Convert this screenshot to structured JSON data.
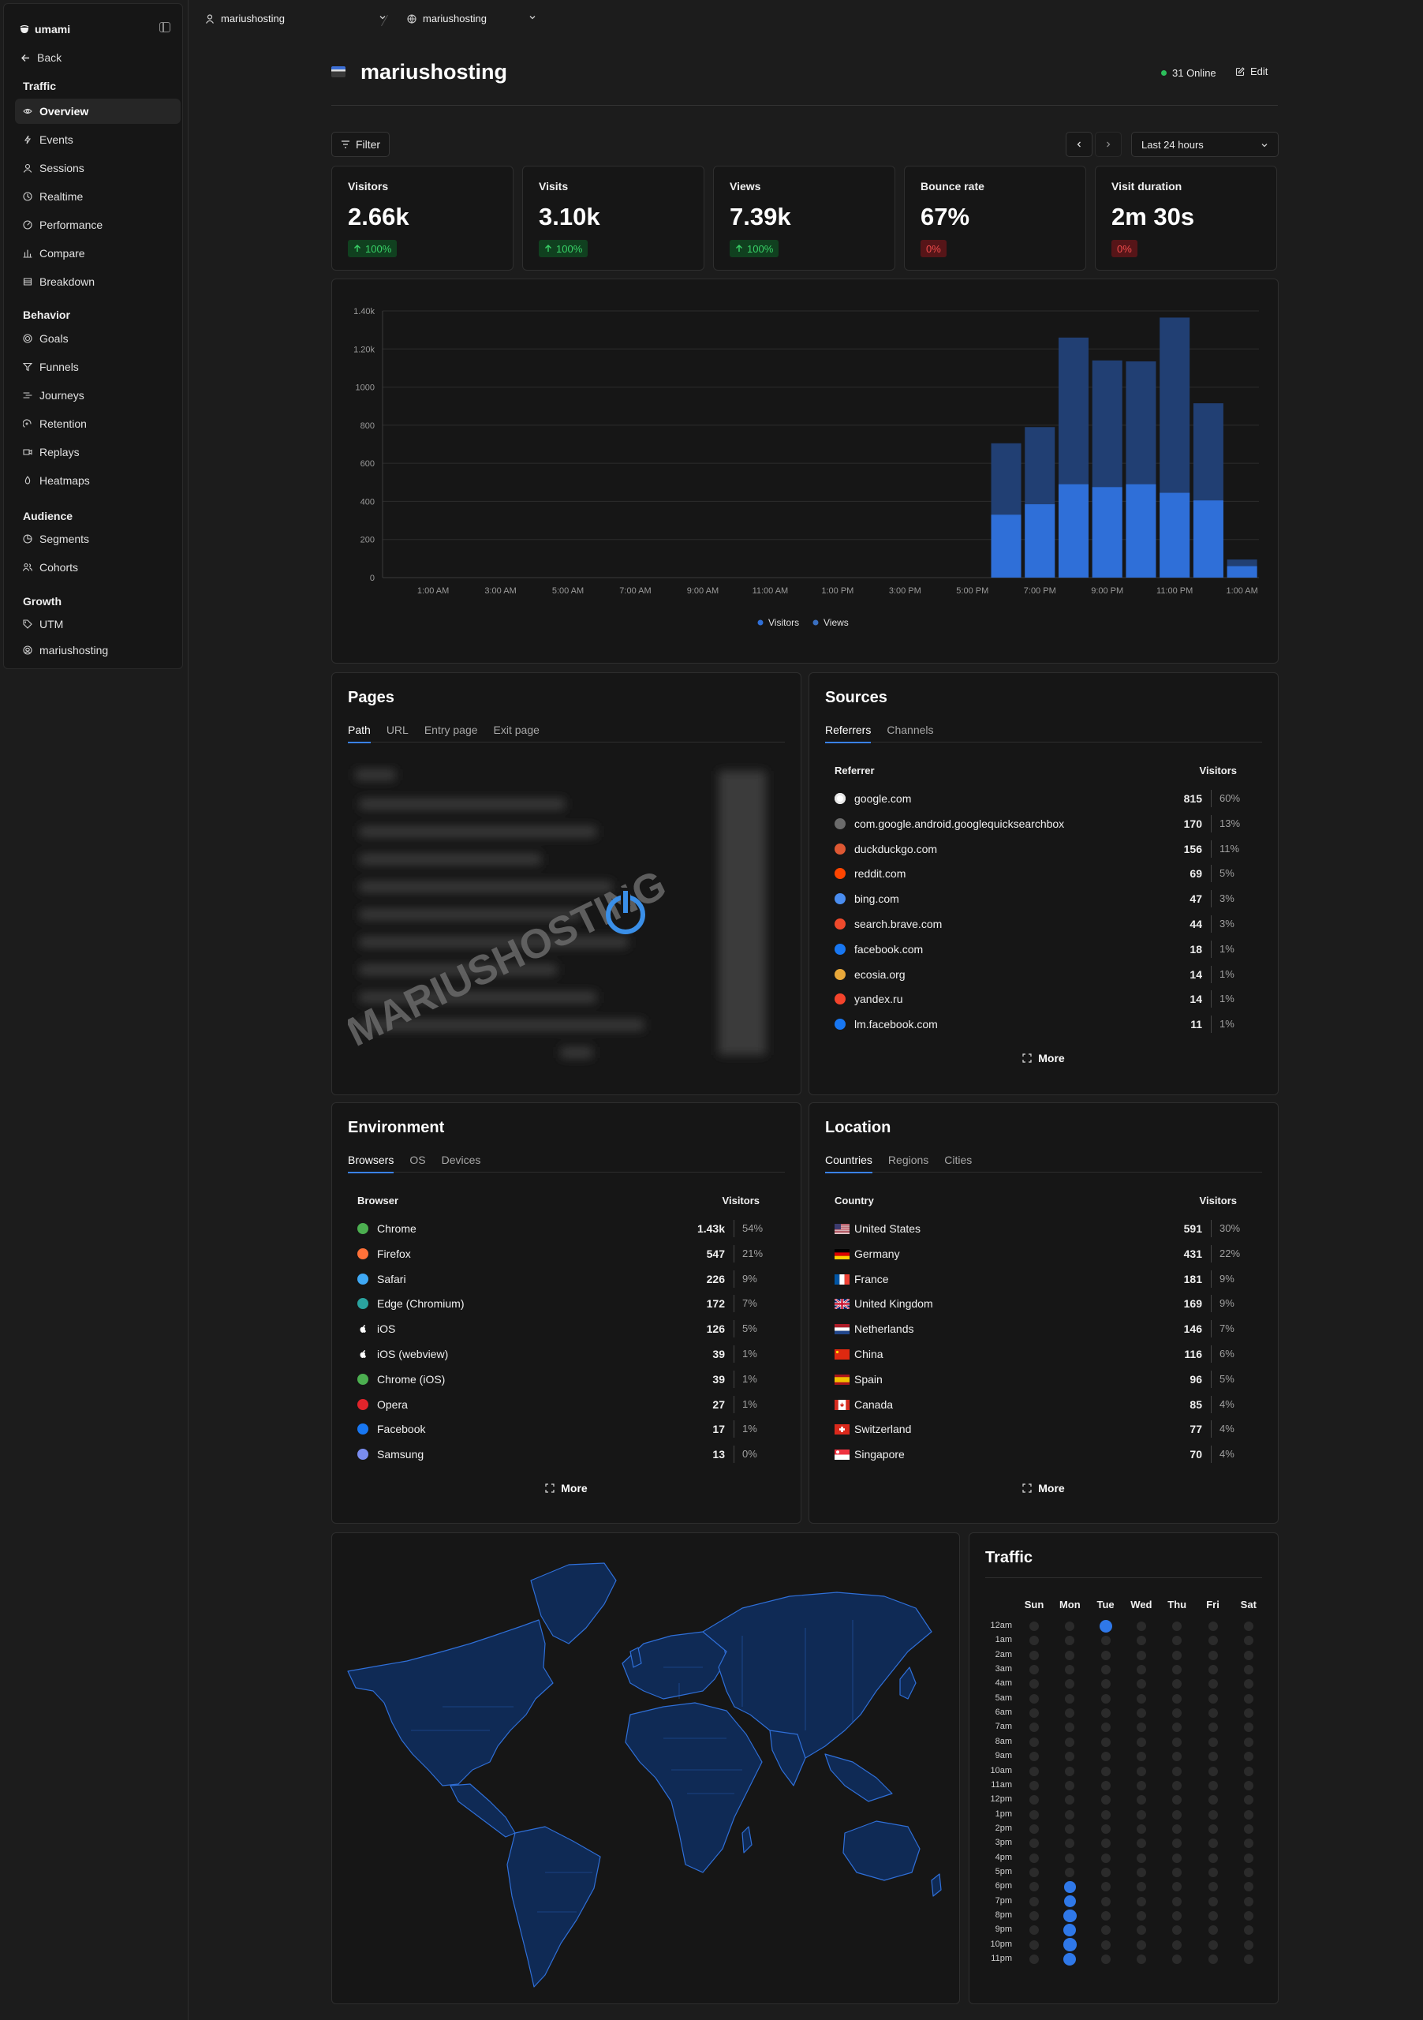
{
  "sidebar": {
    "brand": "umami",
    "back": "Back",
    "sections": [
      {
        "title": "Traffic",
        "items": [
          "Overview",
          "Events",
          "Sessions",
          "Realtime",
          "Performance",
          "Compare",
          "Breakdown"
        ]
      },
      {
        "title": "Behavior",
        "items": [
          "Goals",
          "Funnels",
          "Journeys",
          "Retention",
          "Replays",
          "Heatmaps"
        ]
      },
      {
        "title": "Audience",
        "items": [
          "Segments",
          "Cohorts"
        ]
      },
      {
        "title": "Growth",
        "items": [
          "UTM",
          "mariushosting"
        ]
      }
    ],
    "active_item": "Overview"
  },
  "topbar": {
    "team": "mariushosting",
    "website": "mariushosting"
  },
  "header": {
    "title": "mariushosting",
    "online": "31 Online",
    "edit_label": "Edit"
  },
  "filter": {
    "label": "Filter",
    "date_range": "Last 24 hours"
  },
  "metrics": [
    {
      "label": "Visitors",
      "value": "2.66k",
      "change": "100%",
      "trend": "up"
    },
    {
      "label": "Visits",
      "value": "3.10k",
      "change": "100%",
      "trend": "up"
    },
    {
      "label": "Views",
      "value": "7.39k",
      "change": "100%",
      "trend": "up"
    },
    {
      "label": "Bounce rate",
      "value": "67%",
      "change": "0%",
      "trend": "down"
    },
    {
      "label": "Visit duration",
      "value": "2m 30s",
      "change": "0%",
      "trend": "down"
    }
  ],
  "chart_data": {
    "type": "bar",
    "stacked": "overlay",
    "categories": [
      "12 AM",
      "1 AM",
      "2 AM",
      "3 AM",
      "4 AM",
      "5 AM",
      "6 AM",
      "7 AM",
      "8 AM",
      "9 AM",
      "10 AM",
      "11 AM",
      "12 PM",
      "1 PM",
      "2 PM",
      "3 PM",
      "4 PM",
      "5 PM",
      "6 PM",
      "7 PM",
      "8 PM",
      "9 PM",
      "10 PM",
      "11 PM",
      "12 AM",
      "1 AM"
    ],
    "tick_labels": [
      "1:00 AM",
      "3:00 AM",
      "5:00 AM",
      "7:00 AM",
      "9:00 AM",
      "11:00 AM",
      "1:00 PM",
      "3:00 PM",
      "5:00 PM",
      "7:00 PM",
      "9:00 PM",
      "11:00 PM",
      "1:00 AM"
    ],
    "series": [
      {
        "name": "Visitors",
        "color": "#2f6fd8",
        "values": [
          0,
          0,
          0,
          0,
          0,
          0,
          0,
          0,
          0,
          0,
          0,
          0,
          0,
          0,
          0,
          0,
          0,
          0,
          330,
          385,
          490,
          475,
          490,
          445,
          405,
          60
        ]
      },
      {
        "name": "Views",
        "color": "#213f73",
        "values": [
          0,
          0,
          0,
          0,
          0,
          0,
          0,
          0,
          0,
          0,
          0,
          0,
          0,
          0,
          0,
          0,
          0,
          0,
          705,
          790,
          1260,
          1140,
          1135,
          1365,
          915,
          95
        ]
      }
    ],
    "y_ticks": [
      "0",
      "200",
      "400",
      "600",
      "800",
      "1000",
      "1.20k",
      "1.40k"
    ],
    "ylim": [
      0,
      1400
    ],
    "legend": [
      "Visitors",
      "Views"
    ],
    "legend_position": "bottom"
  },
  "pages": {
    "title": "Pages",
    "tabs": [
      "Path",
      "URL",
      "Entry page",
      "Exit page"
    ],
    "watermark": "MARIUSHOSTING"
  },
  "sources": {
    "title": "Sources",
    "tabs": [
      "Referrers",
      "Channels"
    ],
    "col_label": "Referrer",
    "col_value": "Visitors",
    "rows": [
      {
        "label": "google.com",
        "value": "815",
        "pct": "60%",
        "icon": "google-icon",
        "color": "#e8e8e8"
      },
      {
        "label": "com.google.android.googlequicksearchbox",
        "value": "170",
        "pct": "13%",
        "icon": "app-icon",
        "color": "#6b6b6b"
      },
      {
        "label": "duckduckgo.com",
        "value": "156",
        "pct": "11%",
        "icon": "duckduckgo-icon",
        "color": "#de5833"
      },
      {
        "label": "reddit.com",
        "value": "69",
        "pct": "5%",
        "icon": "reddit-icon",
        "color": "#ff4500"
      },
      {
        "label": "bing.com",
        "value": "47",
        "pct": "3%",
        "icon": "search-icon",
        "color": "#4a8df0"
      },
      {
        "label": "search.brave.com",
        "value": "44",
        "pct": "3%",
        "icon": "brave-icon",
        "color": "#f04a2c"
      },
      {
        "label": "facebook.com",
        "value": "18",
        "pct": "1%",
        "icon": "facebook-icon",
        "color": "#1877f2"
      },
      {
        "label": "ecosia.org",
        "value": "14",
        "pct": "1%",
        "icon": "ecosia-icon",
        "color": "#e8a83a"
      },
      {
        "label": "yandex.ru",
        "value": "14",
        "pct": "1%",
        "icon": "yandex-icon",
        "color": "#f4442c"
      },
      {
        "label": "lm.facebook.com",
        "value": "11",
        "pct": "1%",
        "icon": "facebook-icon",
        "color": "#1877f2"
      }
    ],
    "more": "More"
  },
  "environment": {
    "title": "Environment",
    "tabs": [
      "Browsers",
      "OS",
      "Devices"
    ],
    "col_label": "Browser",
    "col_value": "Visitors",
    "rows": [
      {
        "label": "Chrome",
        "value": "1.43k",
        "pct": "54%",
        "icon": "chrome-icon",
        "color": "#4caf50"
      },
      {
        "label": "Firefox",
        "value": "547",
        "pct": "21%",
        "icon": "firefox-icon",
        "color": "#ff7139"
      },
      {
        "label": "Safari",
        "value": "226",
        "pct": "9%",
        "icon": "safari-icon",
        "color": "#3fa9f5"
      },
      {
        "label": "Edge (Chromium)",
        "value": "172",
        "pct": "7%",
        "icon": "edge-icon",
        "color": "#2aa39f"
      },
      {
        "label": "iOS",
        "value": "126",
        "pct": "5%",
        "icon": "apple-icon",
        "color": "#ffffff"
      },
      {
        "label": "iOS (webview)",
        "value": "39",
        "pct": "1%",
        "icon": "apple-icon",
        "color": "#ffffff"
      },
      {
        "label": "Chrome (iOS)",
        "value": "39",
        "pct": "1%",
        "icon": "chrome-icon",
        "color": "#4caf50"
      },
      {
        "label": "Opera",
        "value": "27",
        "pct": "1%",
        "icon": "opera-icon",
        "color": "#e0242b"
      },
      {
        "label": "Facebook",
        "value": "17",
        "pct": "1%",
        "icon": "facebook-icon",
        "color": "#1877f2"
      },
      {
        "label": "Samsung",
        "value": "13",
        "pct": "0%",
        "icon": "samsung-icon",
        "color": "#7a8df0"
      }
    ],
    "more": "More"
  },
  "location": {
    "title": "Location",
    "tabs": [
      "Countries",
      "Regions",
      "Cities"
    ],
    "col_label": "Country",
    "col_value": "Visitors",
    "rows": [
      {
        "label": "United States",
        "value": "591",
        "pct": "30%",
        "icon": "flag-us"
      },
      {
        "label": "Germany",
        "value": "431",
        "pct": "22%",
        "icon": "flag-de"
      },
      {
        "label": "France",
        "value": "181",
        "pct": "9%",
        "icon": "flag-fr"
      },
      {
        "label": "United Kingdom",
        "value": "169",
        "pct": "9%",
        "icon": "flag-gb"
      },
      {
        "label": "Netherlands",
        "value": "146",
        "pct": "7%",
        "icon": "flag-nl"
      },
      {
        "label": "China",
        "value": "116",
        "pct": "6%",
        "icon": "flag-cn"
      },
      {
        "label": "Spain",
        "value": "96",
        "pct": "5%",
        "icon": "flag-es"
      },
      {
        "label": "Canada",
        "value": "85",
        "pct": "4%",
        "icon": "flag-ca"
      },
      {
        "label": "Switzerland",
        "value": "77",
        "pct": "4%",
        "icon": "flag-ch"
      },
      {
        "label": "Singapore",
        "value": "70",
        "pct": "4%",
        "icon": "flag-sg"
      }
    ],
    "more": "More"
  },
  "traffic": {
    "title": "Traffic",
    "days": [
      "Sun",
      "Mon",
      "Tue",
      "Wed",
      "Thu",
      "Fri",
      "Sat"
    ],
    "hours": [
      "12am",
      "1am",
      "2am",
      "3am",
      "4am",
      "5am",
      "6am",
      "7am",
      "8am",
      "9am",
      "10am",
      "11am",
      "12pm",
      "1pm",
      "2pm",
      "3pm",
      "4pm",
      "5pm",
      "6pm",
      "7pm",
      "8pm",
      "9pm",
      "10pm",
      "11pm"
    ],
    "active_cells": [
      {
        "day": "Tue",
        "hour": "12am",
        "level": 0.7
      },
      {
        "day": "Mon",
        "hour": "6pm",
        "level": 0.45
      },
      {
        "day": "Mon",
        "hour": "7pm",
        "level": 0.55
      },
      {
        "day": "Mon",
        "hour": "8pm",
        "level": 0.75
      },
      {
        "day": "Mon",
        "hour": "9pm",
        "level": 0.7
      },
      {
        "day": "Mon",
        "hour": "10pm",
        "level": 0.75
      },
      {
        "day": "Mon",
        "hour": "11pm",
        "level": 0.7
      }
    ]
  }
}
